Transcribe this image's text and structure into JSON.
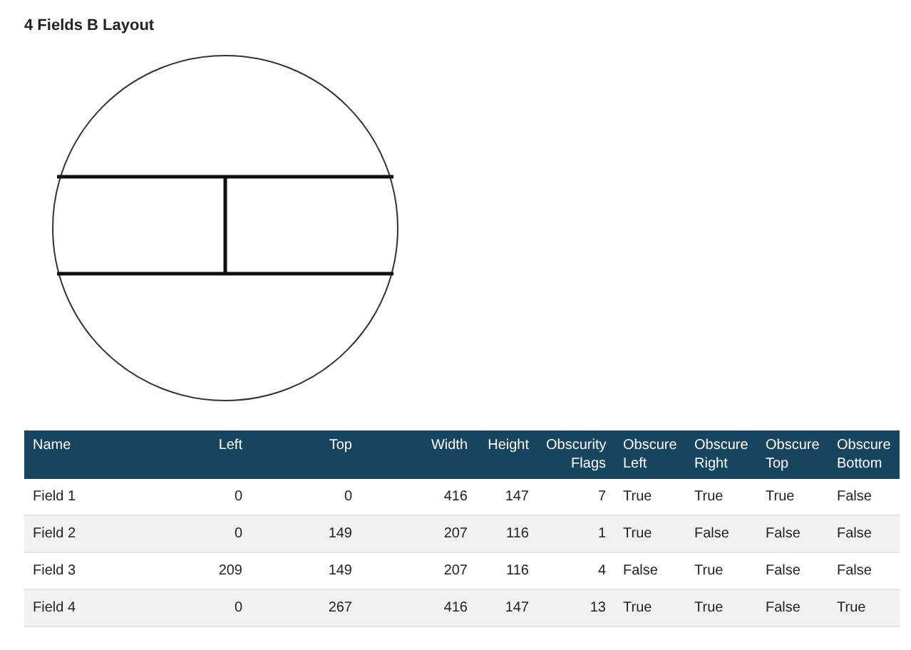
{
  "title": "4 Fields B Layout",
  "table": {
    "columns": [
      "Name",
      "Left",
      "Top",
      "Width",
      "Height",
      "Obscurity Flags",
      "Obscure Left",
      "Obscure Right",
      "Obscure Top",
      "Obscure Bottom"
    ],
    "rows": [
      [
        "Field 1",
        "0",
        "0",
        "416",
        "147",
        "7",
        "True",
        "True",
        "True",
        "False"
      ],
      [
        "Field 2",
        "0",
        "149",
        "207",
        "116",
        "1",
        "True",
        "False",
        "False",
        "False"
      ],
      [
        "Field 3",
        "209",
        "149",
        "207",
        "116",
        "4",
        "False",
        "True",
        "False",
        "False"
      ],
      [
        "Field 4",
        "0",
        "267",
        "416",
        "147",
        "13",
        "True",
        "True",
        "False",
        "True"
      ]
    ]
  }
}
